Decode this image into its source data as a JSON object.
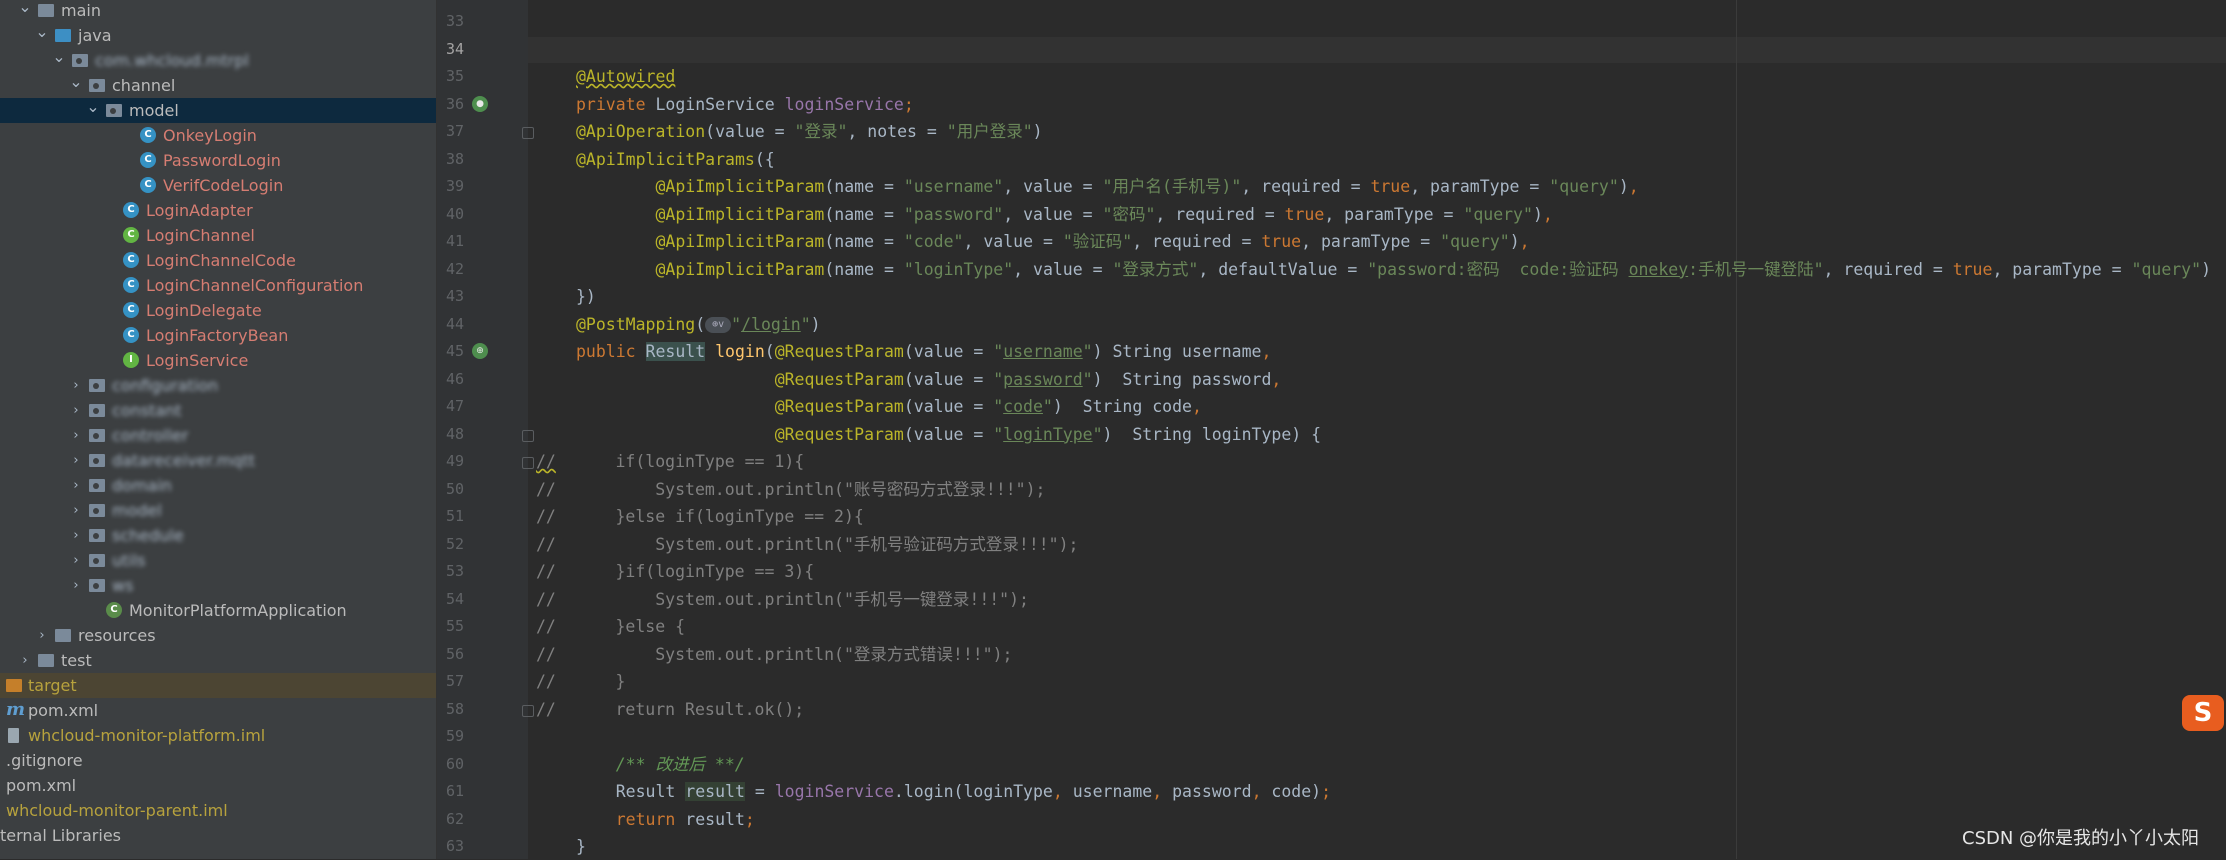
{
  "project_tree": [
    {
      "label": "main",
      "indent": 0,
      "arrow": "v",
      "icon": "folder",
      "color": "white"
    },
    {
      "label": "java",
      "indent": 1,
      "arrow": "v",
      "icon": "folder-src",
      "color": "white"
    },
    {
      "label": "com.whcloud.mtrpl",
      "indent": 2,
      "arrow": "v",
      "icon": "package",
      "color": "blur"
    },
    {
      "label": "channel",
      "indent": 3,
      "arrow": "v",
      "icon": "package",
      "color": "white"
    },
    {
      "label": "model",
      "indent": 4,
      "arrow": "v",
      "icon": "package",
      "color": "white",
      "selected": true
    },
    {
      "label": "OnkeyLogin",
      "indent": 6,
      "arrow": "",
      "icon": "class",
      "color": "red"
    },
    {
      "label": "PasswordLogin",
      "indent": 6,
      "arrow": "",
      "icon": "class",
      "color": "red"
    },
    {
      "label": "VerifCodeLogin",
      "indent": 6,
      "arrow": "",
      "icon": "class",
      "color": "red"
    },
    {
      "label": "LoginAdapter",
      "indent": 5,
      "arrow": "",
      "icon": "class",
      "color": "red"
    },
    {
      "label": "LoginChannel",
      "indent": 5,
      "arrow": "",
      "icon": "class-g",
      "color": "red"
    },
    {
      "label": "LoginChannelCode",
      "indent": 5,
      "arrow": "",
      "icon": "class",
      "color": "red"
    },
    {
      "label": "LoginChannelConfiguration",
      "indent": 5,
      "arrow": "",
      "icon": "class",
      "color": "red"
    },
    {
      "label": "LoginDelegate",
      "indent": 5,
      "arrow": "",
      "icon": "class",
      "color": "red"
    },
    {
      "label": "LoginFactoryBean",
      "indent": 5,
      "arrow": "",
      "icon": "class",
      "color": "red"
    },
    {
      "label": "LoginService",
      "indent": 5,
      "arrow": "",
      "icon": "interface",
      "color": "red"
    },
    {
      "label": "configuration",
      "indent": 3,
      "arrow": ">",
      "icon": "package",
      "color": "blur"
    },
    {
      "label": "constant",
      "indent": 3,
      "arrow": ">",
      "icon": "package",
      "color": "blur"
    },
    {
      "label": "controller",
      "indent": 3,
      "arrow": ">",
      "icon": "package",
      "color": "blur"
    },
    {
      "label": "datareceiver.mqtt",
      "indent": 3,
      "arrow": ">",
      "icon": "package",
      "color": "blur"
    },
    {
      "label": "domain",
      "indent": 3,
      "arrow": ">",
      "icon": "package",
      "color": "blur"
    },
    {
      "label": "model",
      "indent": 3,
      "arrow": ">",
      "icon": "package",
      "color": "blur"
    },
    {
      "label": "schedule",
      "indent": 3,
      "arrow": ">",
      "icon": "package",
      "color": "blur"
    },
    {
      "label": "utils",
      "indent": 3,
      "arrow": ">",
      "icon": "package",
      "color": "blur"
    },
    {
      "label": "ws",
      "indent": 3,
      "arrow": ">",
      "icon": "package",
      "color": "blur"
    },
    {
      "label": "MonitorPlatformApplication",
      "indent": 4,
      "arrow": "",
      "icon": "spring",
      "color": "white"
    },
    {
      "label": "resources",
      "indent": 1,
      "arrow": ">",
      "icon": "folder",
      "color": "white"
    },
    {
      "label": "test",
      "indent": 0,
      "arrow": ">",
      "icon": "folder",
      "color": "white"
    },
    {
      "label": "target",
      "indent": -1,
      "arrow": "",
      "icon": "folder-orange",
      "color": "yellow",
      "target": true
    },
    {
      "label": "pom.xml",
      "indent": -1,
      "arrow": "",
      "icon": "maven",
      "color": "white"
    },
    {
      "label": "whcloud-monitor-platform.iml",
      "indent": -1,
      "arrow": "",
      "icon": "file",
      "color": "yellow"
    },
    {
      "label": ".gitignore",
      "indent": -2,
      "arrow": "",
      "icon": "",
      "color": "white"
    },
    {
      "label": "pom.xml",
      "indent": -2,
      "arrow": "",
      "icon": "",
      "color": "white"
    },
    {
      "label": "whcloud-monitor-parent.iml",
      "indent": -2,
      "arrow": "",
      "icon": "",
      "color": "yellow"
    },
    {
      "label": "ternal Libraries",
      "indent": -2,
      "arrow": "",
      "icon": "",
      "color": "white"
    }
  ],
  "editor": {
    "lines": [
      {
        "n": "33",
        "html": ""
      },
      {
        "n": "34",
        "html": "",
        "current": true
      },
      {
        "n": "35",
        "html": "<span class='ann warn'>@Autowired</span>"
      },
      {
        "n": "36",
        "html": "<span class='kw'>private </span>LoginService <span class='field'>loginService</span><span class='kw'>;</span>",
        "gicon": "bean-icon"
      },
      {
        "n": "37",
        "html": "<span class='ann'>@ApiOperation</span>(value = <span class='str'>\"登录\"</span>, notes = <span class='str'>\"用户登录\"</span>)",
        "fold": true
      },
      {
        "n": "38",
        "html": "<span class='ann'>@ApiImplicitParams</span>({"
      },
      {
        "n": "39",
        "html": "        <span class='ann'>@ApiImplicitParam</span>(name = <span class='str'>\"username\"</span>, value = <span class='str'>\"用户名(手机号)\"</span>, required = <span class='kw'>true</span>, paramType = <span class='str'>\"query\"</span>)<span class='kw'>,</span>"
      },
      {
        "n": "40",
        "html": "        <span class='ann'>@ApiImplicitParam</span>(name = <span class='str'>\"password\"</span>, value = <span class='str'>\"密码\"</span>, required = <span class='kw'>true</span>, paramType = <span class='str'>\"query\"</span>)<span class='kw'>,</span>"
      },
      {
        "n": "41",
        "html": "        <span class='ann'>@ApiImplicitParam</span>(name = <span class='str'>\"code\"</span>, value = <span class='str'>\"验证码\"</span>, required = <span class='kw'>true</span>, paramType = <span class='str'>\"query\"</span>)<span class='kw'>,</span>"
      },
      {
        "n": "42",
        "html": "        <span class='ann'>@ApiImplicitParam</span>(name = <span class='str'>\"loginType\"</span>, value = <span class='str'>\"登录方式\"</span>, defaultValue = <span class='str'>\"password:密码  code:验证码 <span class='u'>onekey</span>:手机号一键登陆\"</span>, required = <span class='kw'>true</span>, paramType = <span class='str'>\"query\"</span>)"
      },
      {
        "n": "43",
        "html": "})"
      },
      {
        "n": "44",
        "html": "<span class='ann'>@PostMapping</span>(<span class='globe'>⊕v</span><span class='str'>\"<span class='u'>/login</span>\"</span>)"
      },
      {
        "n": "45",
        "html": "<span class='kw'>public </span><span class='hl'>Result</span> <span class='fn'>login</span>(<span class='ann'>@RequestParam</span>(value = <span class='str'>\"<span class='u'>username</span>\"</span>) String username<span class='kw'>,</span>",
        "gicon": "web-icon"
      },
      {
        "n": "46",
        "html": "                    <span class='ann'>@RequestParam</span>(value = <span class='str'>\"<span class='u'>password</span>\"</span>)  String password<span class='kw'>,</span>"
      },
      {
        "n": "47",
        "html": "                    <span class='ann'>@RequestParam</span>(value = <span class='str'>\"<span class='u'>code</span>\"</span>)  String code<span class='kw'>,</span>"
      },
      {
        "n": "48",
        "html": "                    <span class='ann'>@RequestParam</span>(value = <span class='str'>\"<span class='u'>loginType</span>\"</span>)  String loginType) {",
        "fold": true
      },
      {
        "n": "49",
        "html": "<span class='cmt'><span class='warn'>//</span>      if(loginType == 1){</span>",
        "comment_col": true,
        "fold": true
      },
      {
        "n": "50",
        "html": "<span class='cmt'>//          System.out.println(\"账号密码方式登录!!!\");</span>",
        "comment_col": true
      },
      {
        "n": "51",
        "html": "<span class='cmt'>//      }else if(loginType == 2){</span>",
        "comment_col": true
      },
      {
        "n": "52",
        "html": "<span class='cmt'>//          System.out.println(\"手机号验证码方式登录!!!\");</span>",
        "comment_col": true
      },
      {
        "n": "53",
        "html": "<span class='cmt'>//      }if(loginType == 3){</span>",
        "comment_col": true
      },
      {
        "n": "54",
        "html": "<span class='cmt'>//          System.out.println(\"手机号一键登录!!!\");</span>",
        "comment_col": true
      },
      {
        "n": "55",
        "html": "<span class='cmt'>//      }else {</span>",
        "comment_col": true
      },
      {
        "n": "56",
        "html": "<span class='cmt'>//          System.out.println(\"登录方式错误!!!\");</span>",
        "comment_col": true
      },
      {
        "n": "57",
        "html": "<span class='cmt'>//      }</span>",
        "comment_col": true
      },
      {
        "n": "58",
        "html": "<span class='cmt'>//      return Result.ok();</span>",
        "comment_col": true,
        "fold": true
      },
      {
        "n": "59",
        "html": ""
      },
      {
        "n": "60",
        "html": "    <span class='doc'>/** 改进后 **/</span>"
      },
      {
        "n": "61",
        "html": "    Result <span class='hl2'>result</span> = <span class='field'>loginService</span>.login(loginType<span class='kw'>,</span> username<span class='kw'>,</span> password<span class='kw'>,</span> code)<span class='kw'>;</span>"
      },
      {
        "n": "62",
        "html": "    <span class='kw'>return </span>result<span class='kw'>;</span>"
      },
      {
        "n": "63",
        "html": "}"
      }
    ]
  },
  "overlay": {
    "ime_badge": "S",
    "watermark": "CSDN @你是我的小丫小太阳"
  }
}
